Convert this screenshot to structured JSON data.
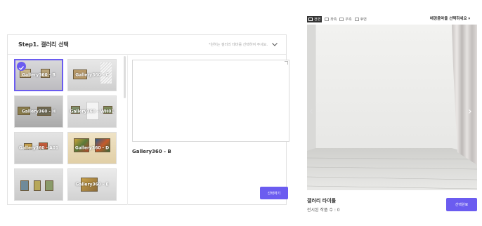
{
  "step": {
    "title": "Step1. 갤러리 선택",
    "hint": "*원하는 갤러리 테마를 선택하여 주세요.",
    "collapse_icon": "chevron-down-icon"
  },
  "thumbnails": [
    {
      "label": "Gallery360 - B",
      "selected": true
    },
    {
      "label": "Gallery360 - C",
      "selected": false
    },
    {
      "label": "Gallery360 - H",
      "selected": false
    },
    {
      "label": "Gallery360 - WH01",
      "selected": false
    },
    {
      "label": "Gallery360 - A01",
      "selected": false
    },
    {
      "label": "Gallery360 - D",
      "selected": false
    },
    {
      "label": "",
      "selected": false
    },
    {
      "label": "Gallery360 - E",
      "selected": false
    }
  ],
  "preview": {
    "selected_name": "Gallery360 - B",
    "select_button": "선택하기"
  },
  "viewer": {
    "tabs": [
      {
        "label": "전면",
        "active": true
      },
      {
        "label": "좌측",
        "active": false
      },
      {
        "label": "우측",
        "active": false
      },
      {
        "label": "후면",
        "active": false
      }
    ],
    "music_select": "배경음악을 선택하세요 ▾",
    "arrow_left": "‹",
    "arrow_right": "›"
  },
  "info": {
    "gallery_title": "갤러리 타이틀",
    "artwork_count": "전시된 작품 수 : 0",
    "complete_button": "선택완료"
  },
  "colors": {
    "accent": "#6b5cf0",
    "wall": "#ececea",
    "floor": "#d6d6d3"
  }
}
